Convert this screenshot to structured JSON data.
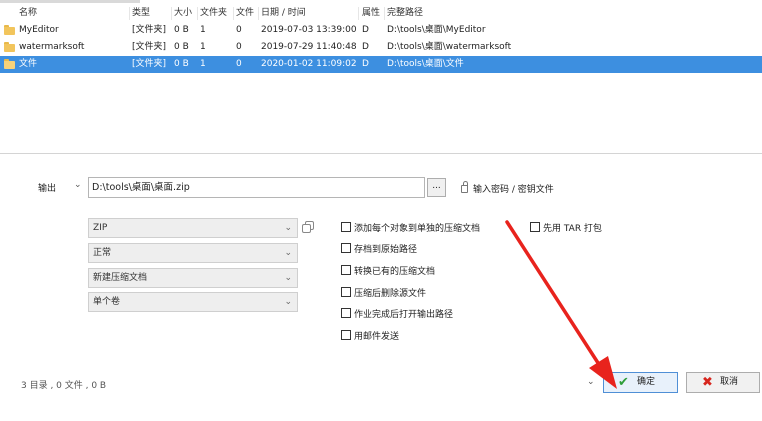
{
  "columns": {
    "name": "名称",
    "type": "类型",
    "size": "大小",
    "folders": "文件夹",
    "files": "文件",
    "date": "日期 / 时间",
    "attr": "属性",
    "path": "完整路径"
  },
  "rows": [
    {
      "name": "MyEditor",
      "type": "[文件夹]",
      "size": "0 B",
      "folders": "1",
      "files": "0",
      "date": "2019-07-03 13:39:00",
      "attr": "D",
      "path": "D:\\tools\\桌面\\MyEditor",
      "icon": "folder-icon"
    },
    {
      "name": "watermarksoft",
      "type": "[文件夹]",
      "size": "0 B",
      "folders": "1",
      "files": "0",
      "date": "2019-07-29 11:40:48",
      "attr": "D",
      "path": "D:\\tools\\桌面\\watermarksoft",
      "icon": "folder-icon"
    },
    {
      "name": "文件",
      "type": "[文件夹]",
      "size": "0 B",
      "folders": "1",
      "files": "0",
      "date": "2020-01-02 11:09:02",
      "attr": "D",
      "path": "D:\\tools\\桌面\\文件",
      "icon": "folder-icon",
      "selected": true
    }
  ],
  "output": {
    "label": "输出",
    "path": "D:\\tools\\桌面\\桌面.zip",
    "browse_label": "...",
    "password_link": "输入密码 / 密钥文件"
  },
  "dropdowns": {
    "format": "ZIP",
    "level": "正常",
    "mode": "新建压缩文档",
    "volume": "单个卷"
  },
  "options": {
    "separate_archives": "添加每个对象到单独的压缩文档",
    "store_original_path": "存档到原始路径",
    "convert_existing": "转换已有的压缩文档",
    "delete_source": "压缩后删除源文件",
    "open_output_path": "作业完成后打开输出路径",
    "send_by_mail": "用邮件发送",
    "tar_first": "先用 TAR 打包"
  },
  "footer": {
    "status": "3 目录 , 0 文件 , 0 B",
    "ok_label": "确定",
    "cancel_label": "取消"
  },
  "colors": {
    "selection": "#3d8fe0",
    "folder": "#f2c55c",
    "ok_icon": "#2e9e3a",
    "cancel_icon": "#d7261e",
    "annotation_arrow": "#e8231d"
  }
}
